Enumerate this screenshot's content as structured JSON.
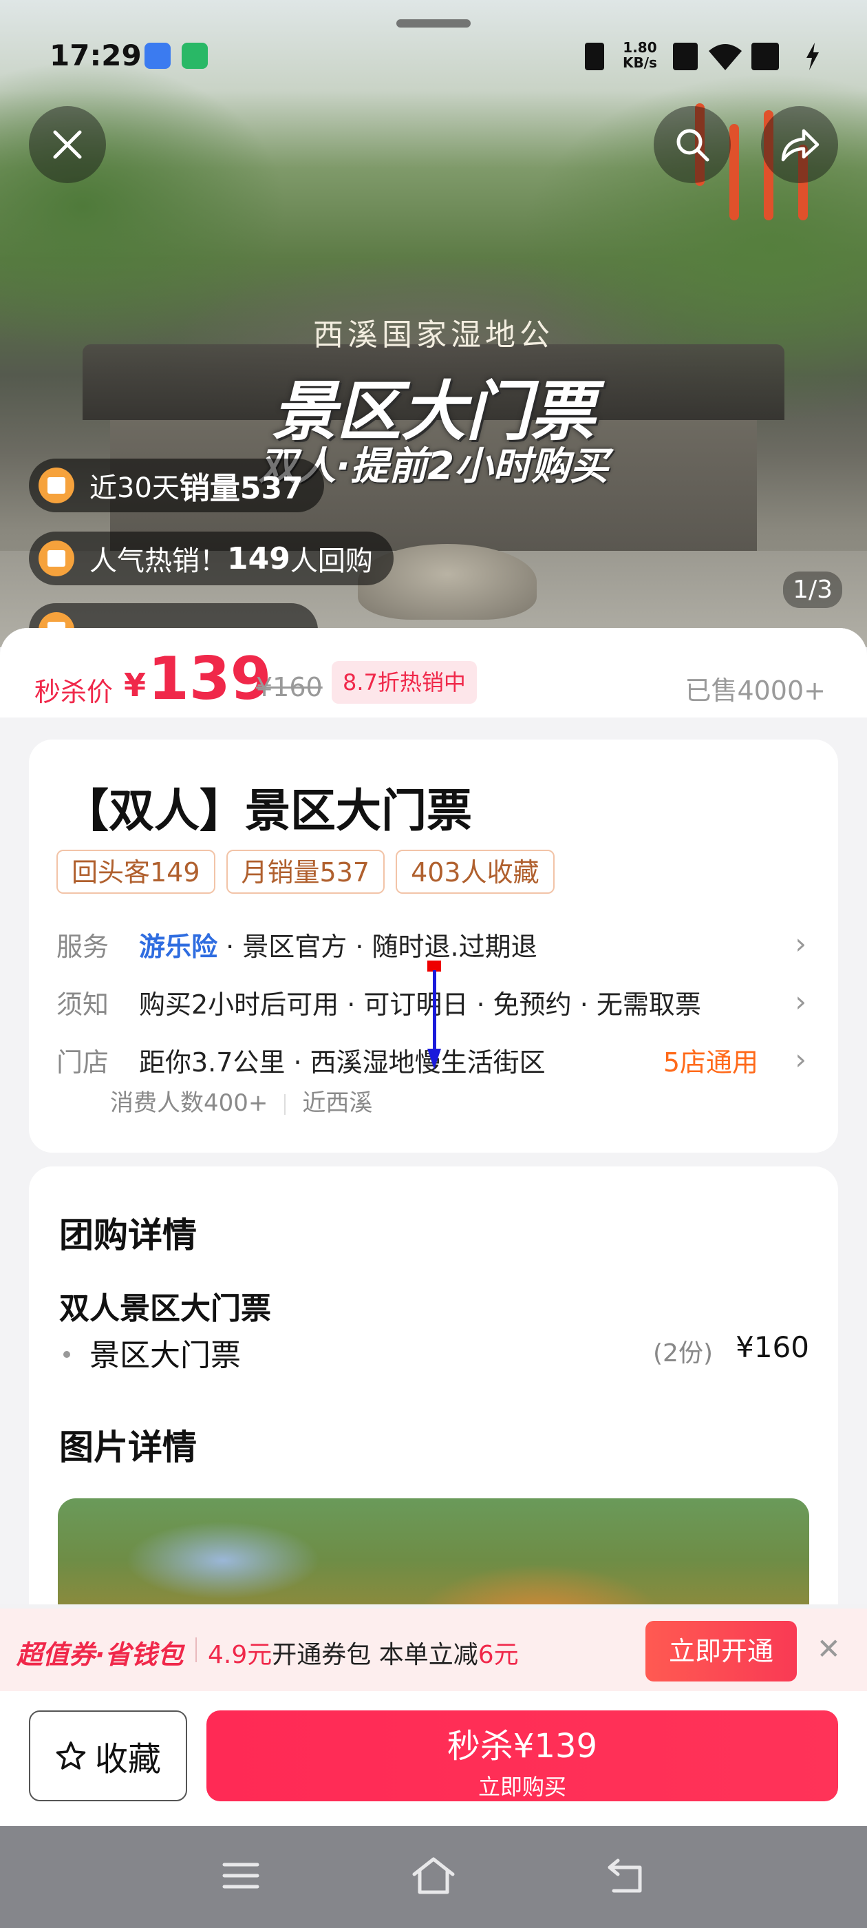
{
  "status_bar": {
    "time": "17:29",
    "network_speed_value": "1.80",
    "network_speed_unit": "KB/s"
  },
  "hero": {
    "sign_text": "西溪国家湿地公",
    "overlay_title": "景区大门票",
    "overlay_subtitle": "双人·提前2小时购买",
    "pager": "1/3",
    "pills": [
      {
        "text_prefix": "近30天",
        "text_bold": "销量537",
        "text_suffix": ""
      },
      {
        "text_prefix": "人气热销！",
        "text_bold": "149",
        "text_suffix": "人回购"
      }
    ]
  },
  "price": {
    "label": "秒杀价",
    "currency": "¥",
    "value": "139",
    "original": "¥160",
    "discount_badge": "8.7折热销中",
    "sold": "已售4000+"
  },
  "product": {
    "title": "【双人】景区大门票",
    "tags": [
      "回头客149",
      "月销量537",
      "403人收藏"
    ],
    "service": {
      "key": "服务",
      "highlight": "游乐险",
      "rest": " · 景区官方 · 随时退.过期退"
    },
    "notice": {
      "key": "须知",
      "value": "购买2小时后可用 · 可订明日 · 免预约 · 无需取票"
    },
    "store": {
      "key": "门店",
      "value": "距你3.7公里 · 西溪湿地慢生活街区",
      "right": "5店通用",
      "sub_left": "消费人数400+",
      "sub_right": "近西溪"
    }
  },
  "details": {
    "heading": "团购详情",
    "package_name": "双人景区大门票",
    "item_name": "景区大门票",
    "item_qty": "(2份)",
    "item_price": "¥160",
    "images_heading": "图片详情"
  },
  "coupon_banner": {
    "brand": "超值券·省钱包",
    "text_price": "4.9元",
    "text_mid": "开通券包 本单立减",
    "text_save": "6元",
    "button": "立即开通"
  },
  "bottom_bar": {
    "favorite_label": "收藏",
    "buy_line1": "秒杀¥139",
    "buy_line2": "立即购买"
  },
  "colors": {
    "accent": "#f0284a",
    "orange": "#ff6a1a",
    "blue": "#2f6de0"
  }
}
